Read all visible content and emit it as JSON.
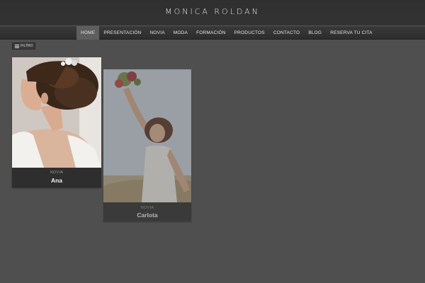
{
  "site": {
    "logo": "MONICA ROLDAN"
  },
  "nav": {
    "items": [
      {
        "label": "HOME"
      },
      {
        "label": "PRESENTACIÓN"
      },
      {
        "label": "NOVIA"
      },
      {
        "label": "MODA"
      },
      {
        "label": "FORMACIÓN"
      },
      {
        "label": "PRODUCTOS"
      },
      {
        "label": "CONTACTO"
      },
      {
        "label": "BLOG"
      },
      {
        "label": "RESERVA TU CITA"
      }
    ]
  },
  "filter": {
    "label": "FILTRO",
    "icon": "list-icon"
  },
  "cards": [
    {
      "category": "NOVIA",
      "title": "Ana"
    },
    {
      "category": "NOVIA",
      "title": "Carlota"
    }
  ],
  "colors": {
    "background": "#4f4f4f",
    "nav_active": "#5e5e5e",
    "card": "#2e2e2e"
  }
}
